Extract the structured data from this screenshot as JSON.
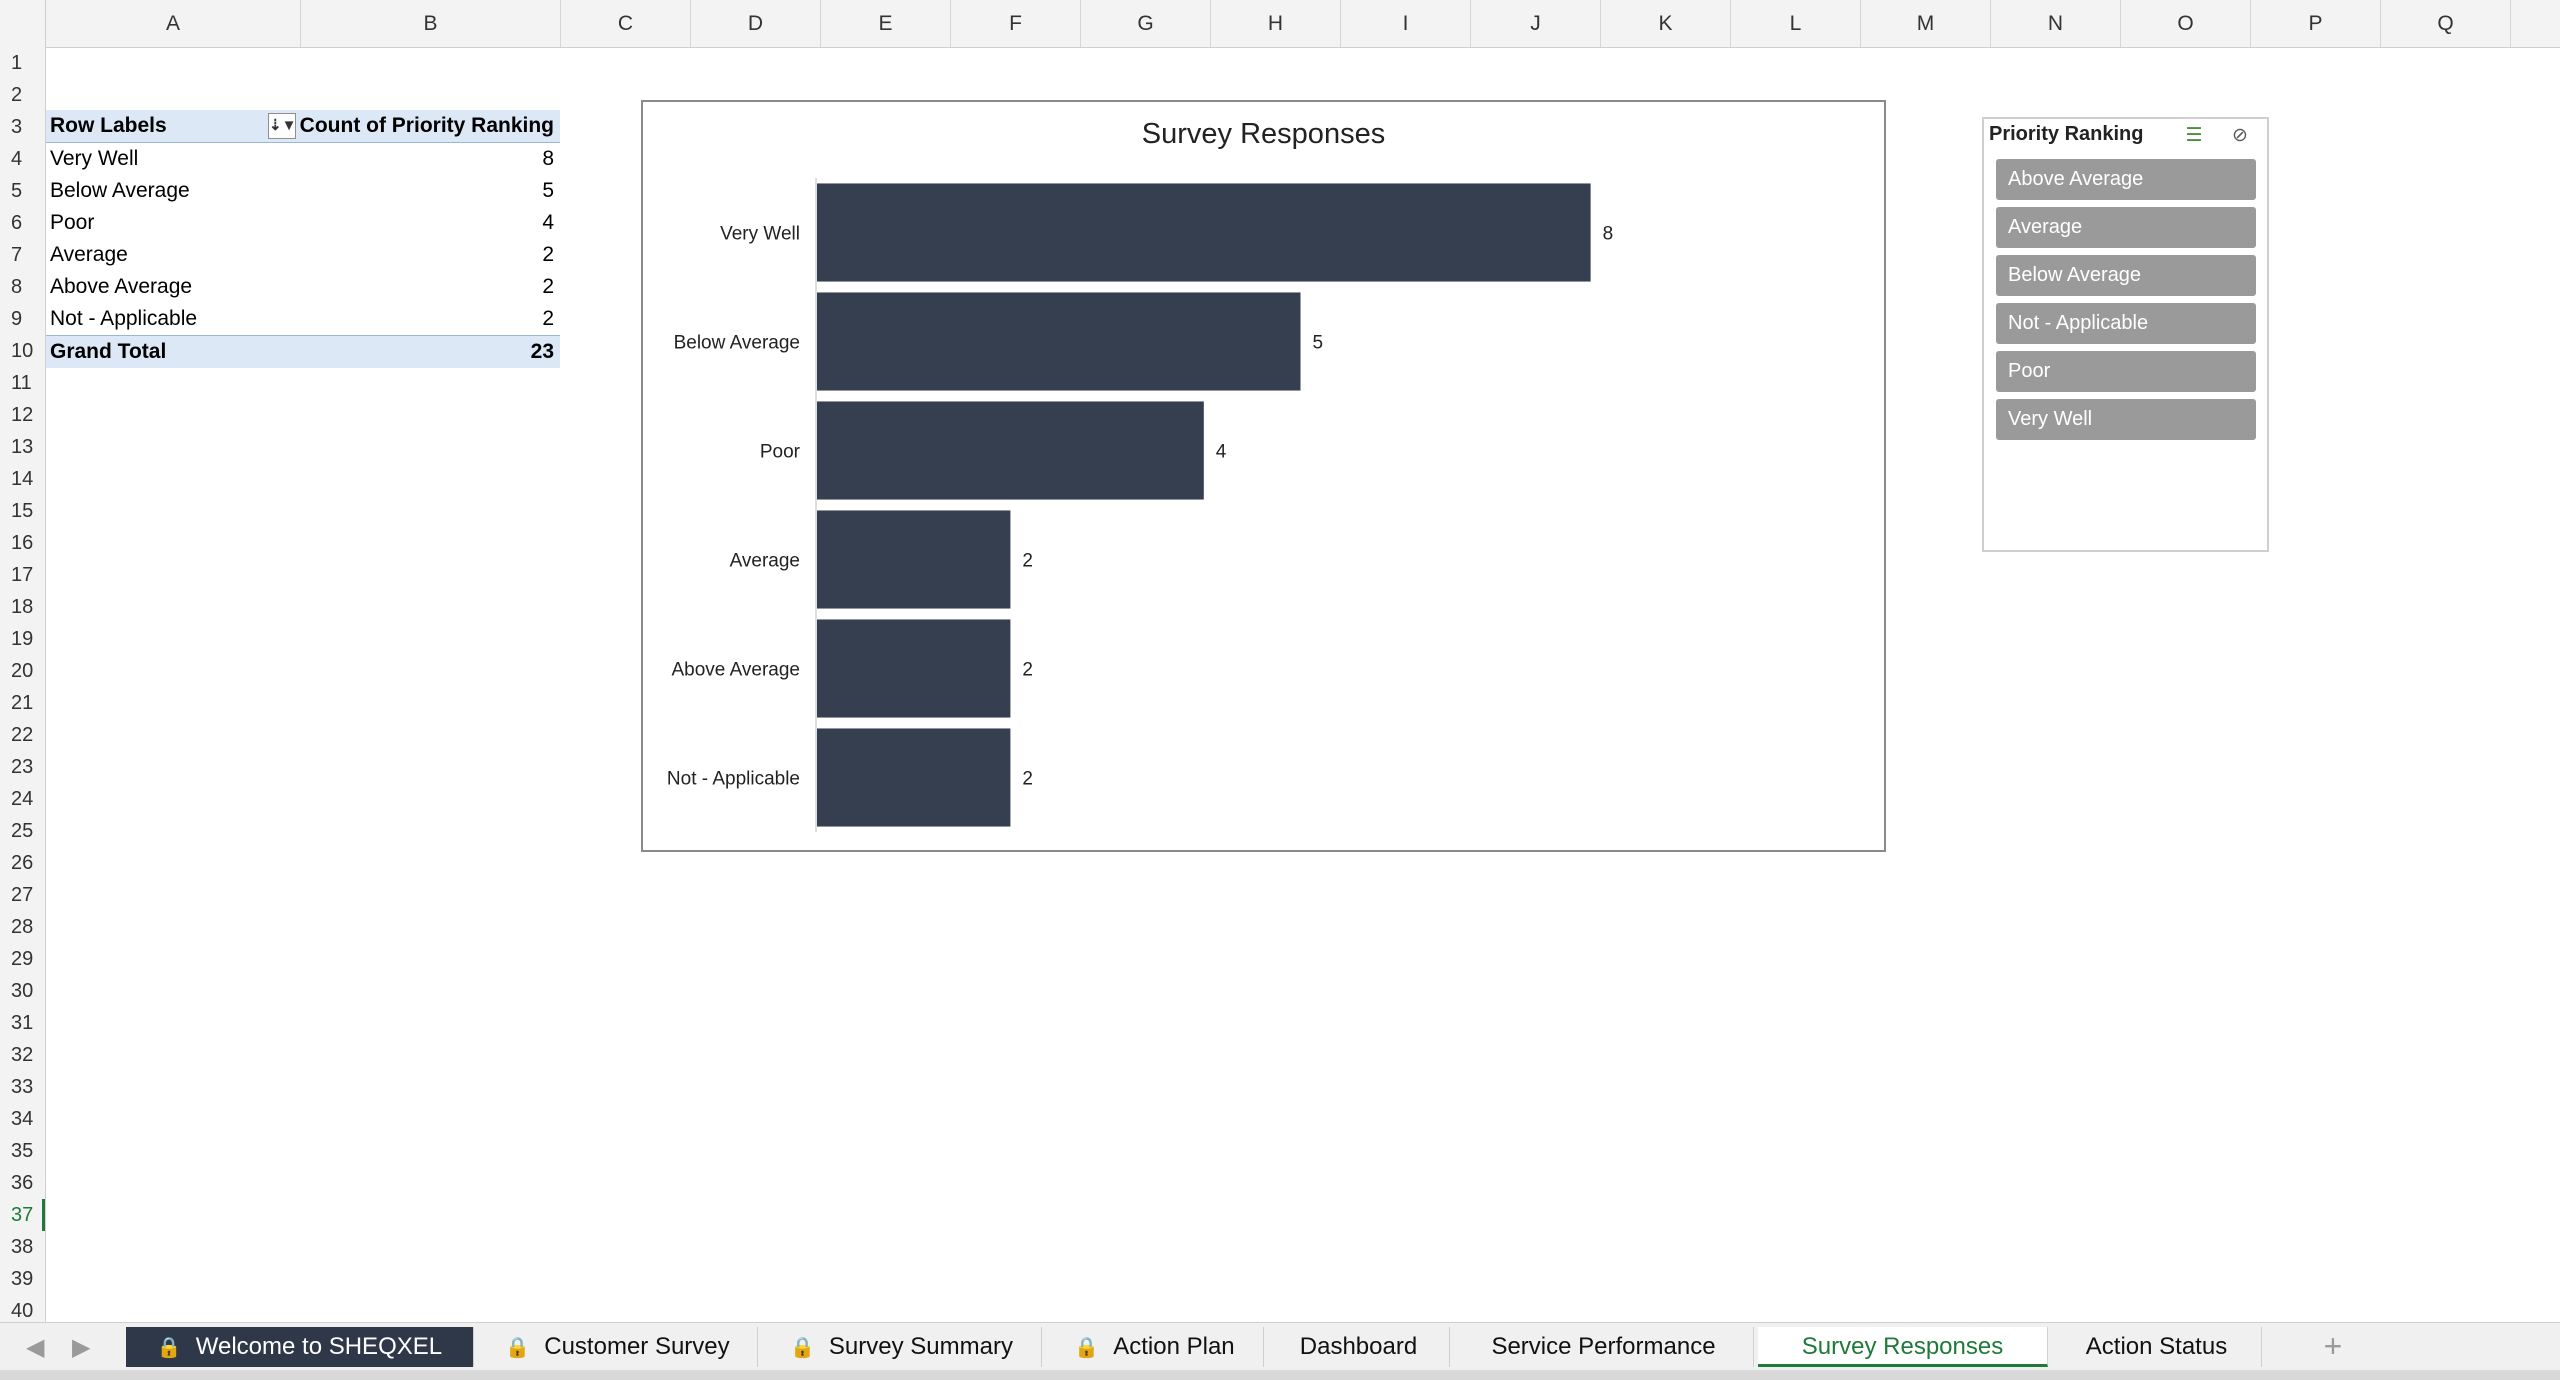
{
  "columns": [
    "A",
    "B",
    "C",
    "D",
    "E",
    "F",
    "G",
    "H",
    "I",
    "J",
    "K",
    "L",
    "M",
    "N",
    "O",
    "P",
    "Q"
  ],
  "rows": [
    "1",
    "2",
    "3",
    "4",
    "5",
    "6",
    "7",
    "8",
    "9",
    "10",
    "11",
    "12",
    "13",
    "14",
    "15",
    "16",
    "17",
    "18",
    "19",
    "20",
    "21",
    "22",
    "23",
    "24",
    "25",
    "26",
    "27",
    "28",
    "29",
    "30",
    "31",
    "32",
    "33",
    "34",
    "35",
    "36",
    "37",
    "38",
    "39",
    "40"
  ],
  "pivot": {
    "header_label": "Row Labels",
    "header_value": "Count of Priority Ranking",
    "rows": [
      {
        "label": "Very Well",
        "value": "8"
      },
      {
        "label": "Below Average",
        "value": "5"
      },
      {
        "label": "Poor",
        "value": "4"
      },
      {
        "label": "Average",
        "value": "2"
      },
      {
        "label": "Above Average",
        "value": "2"
      },
      {
        "label": "Not - Applicable",
        "value": "2"
      }
    ],
    "total_label": "Grand Total",
    "total_value": "23"
  },
  "chart_data": {
    "type": "bar",
    "orientation": "horizontal",
    "title": "Survey Responses",
    "categories": [
      "Very Well",
      "Below Average",
      "Poor",
      "Average",
      "Above Average",
      "Not - Applicable"
    ],
    "values": [
      8,
      5,
      4,
      2,
      2,
      2
    ],
    "bar_color": "#353f4f",
    "xlim": [
      0,
      10
    ],
    "xlabel": "",
    "ylabel": "",
    "data_labels": true,
    "grid": false
  },
  "slicer": {
    "title": "Priority Ranking",
    "items": [
      "Above Average",
      "Average",
      "Below Average",
      "Not - Applicable",
      "Poor",
      "Very Well"
    ]
  },
  "tabs": [
    {
      "label": "Welcome to SHEQXEL",
      "locked": true
    },
    {
      "label": "Customer Survey",
      "locked": true
    },
    {
      "label": "Survey Summary",
      "locked": true
    },
    {
      "label": "Action Plan",
      "locked": true
    },
    {
      "label": "Dashboard",
      "locked": false
    },
    {
      "label": "Service Performance",
      "locked": false
    },
    {
      "label": "Survey Responses",
      "locked": false
    },
    {
      "label": "Action Status",
      "locked": false
    }
  ],
  "active_tab": "Survey Responses",
  "active_row": "37",
  "colors": {
    "accent": "#1f7a3a",
    "bar": "#353f4f",
    "slicer_item": "#9a9a9a"
  }
}
